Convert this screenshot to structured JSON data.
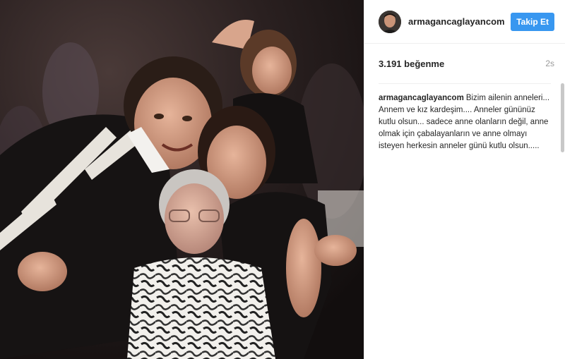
{
  "post": {
    "photo": {
      "alt_icon": "family-photo"
    },
    "header": {
      "username": "armagancaglayancom",
      "follow_label": "Takip Et",
      "avatar_icon": "profile-avatar"
    },
    "stats": {
      "likes": "3.191 beğenme",
      "time": "2s"
    },
    "caption": {
      "username": "armagancaglayancom",
      "text": "Bizim ailenin anneleri... Annem ve kız kardeşim.... Anneler gününüz kutlu olsun... sadece anne olanların değil, anne olmak için çabalayanların ve anne olmayı isteyen herkesin anneler günü kutlu olsun....."
    }
  },
  "colors": {
    "follow_button": "#3897f0",
    "text": "#262626",
    "muted": "#999999",
    "divider": "#efefef"
  }
}
